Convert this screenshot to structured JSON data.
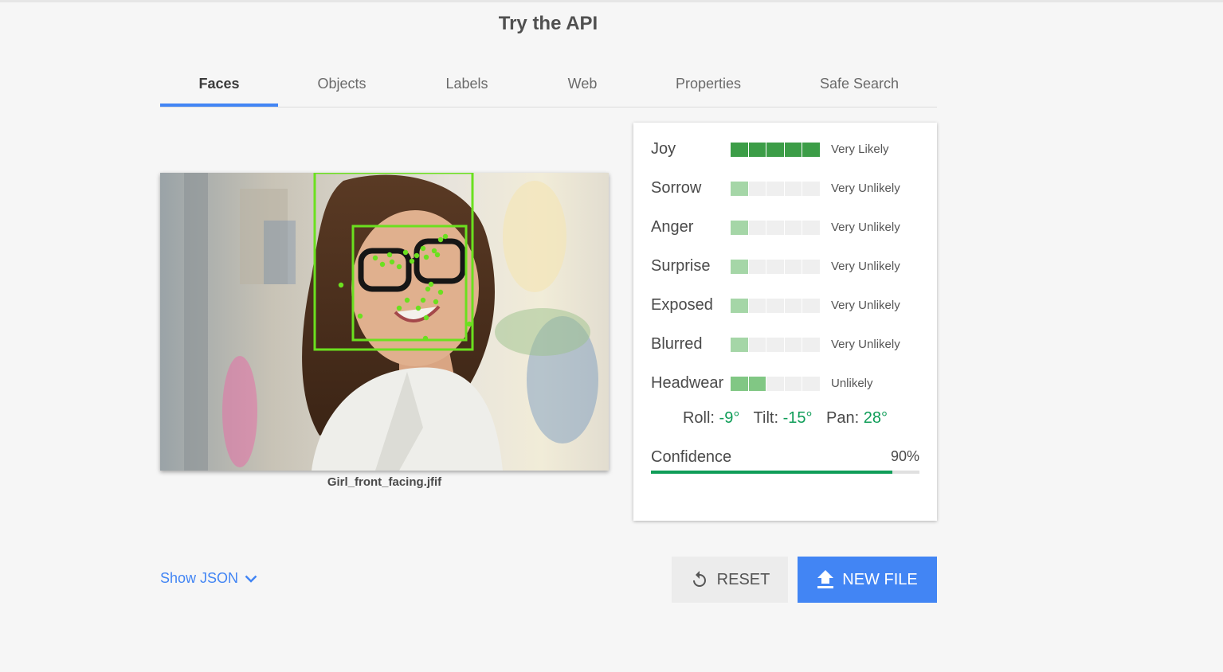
{
  "page": {
    "title": "Try the API"
  },
  "tabs": [
    {
      "label": "Faces",
      "active": true
    },
    {
      "label": "Objects"
    },
    {
      "label": "Labels"
    },
    {
      "label": "Web"
    },
    {
      "label": "Properties"
    },
    {
      "label": "Safe Search"
    }
  ],
  "image": {
    "filename": "Girl_front_facing.jfif"
  },
  "attributes": [
    {
      "label": "Joy",
      "likelihood": "Very Likely",
      "level": 5
    },
    {
      "label": "Sorrow",
      "likelihood": "Very Unlikely",
      "level": 1
    },
    {
      "label": "Anger",
      "likelihood": "Very Unlikely",
      "level": 1
    },
    {
      "label": "Surprise",
      "likelihood": "Very Unlikely",
      "level": 1
    },
    {
      "label": "Exposed",
      "likelihood": "Very Unlikely",
      "level": 1
    },
    {
      "label": "Blurred",
      "likelihood": "Very Unlikely",
      "level": 1
    },
    {
      "label": "Headwear",
      "likelihood": "Unlikely",
      "level": 2
    }
  ],
  "angles": {
    "roll_label": "Roll:",
    "roll": "-9°",
    "tilt_label": "Tilt:",
    "tilt": "-15°",
    "pan_label": "Pan:",
    "pan": "28°"
  },
  "confidence": {
    "label": "Confidence",
    "value": "90%",
    "fraction": 0.9
  },
  "actions": {
    "show_json": "Show JSON",
    "reset": "RESET",
    "new_file": "NEW FILE"
  },
  "colors": {
    "accent": "#4285f4",
    "green": "#0f9d58",
    "likely_bar": "#3c9d47",
    "unlikely_bar": "#a5d6a7",
    "headwear_bar": "#81c784",
    "face_box": "#6be01f"
  },
  "icons": {
    "reset": "refresh-icon",
    "new_file": "upload-icon",
    "show_json": "chevron-down-icon"
  }
}
